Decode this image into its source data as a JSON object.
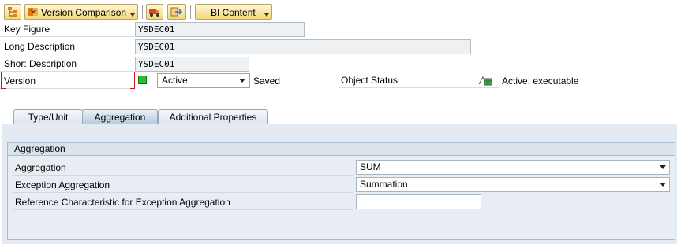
{
  "toolbar": {
    "version_comparison_label": "Version Comparison",
    "bi_content_label": "BI Content"
  },
  "header": {
    "key_figure_label": "Key Figure",
    "key_figure_value": "YSDEC01",
    "long_description_label": "Long Description",
    "long_description_value": "YSDEC01",
    "short_description_label": "Shor: Description",
    "short_description_value": "YSDEC01",
    "version_label": "Version",
    "version_value": "Active",
    "version_saved": "Saved",
    "object_status_label": "Object Status",
    "object_status_value": "Active, executable"
  },
  "tabs": [
    {
      "label": "Type/Unit"
    },
    {
      "label": "Aggregation"
    },
    {
      "label": "Additional Properties"
    }
  ],
  "aggregation_group": {
    "title": "Aggregation",
    "aggregation_label": "Aggregation",
    "aggregation_value": "SUM",
    "exception_aggregation_label": "Exception Aggregation",
    "exception_aggregation_value": "Summation",
    "reference_characteristic_label": "Reference Characteristic for Exception Aggregation",
    "reference_characteristic_value": ""
  },
  "colors": {
    "status_green": "#22c02a",
    "tab_active": "#b7c9db",
    "required_marker": "#d01010"
  }
}
